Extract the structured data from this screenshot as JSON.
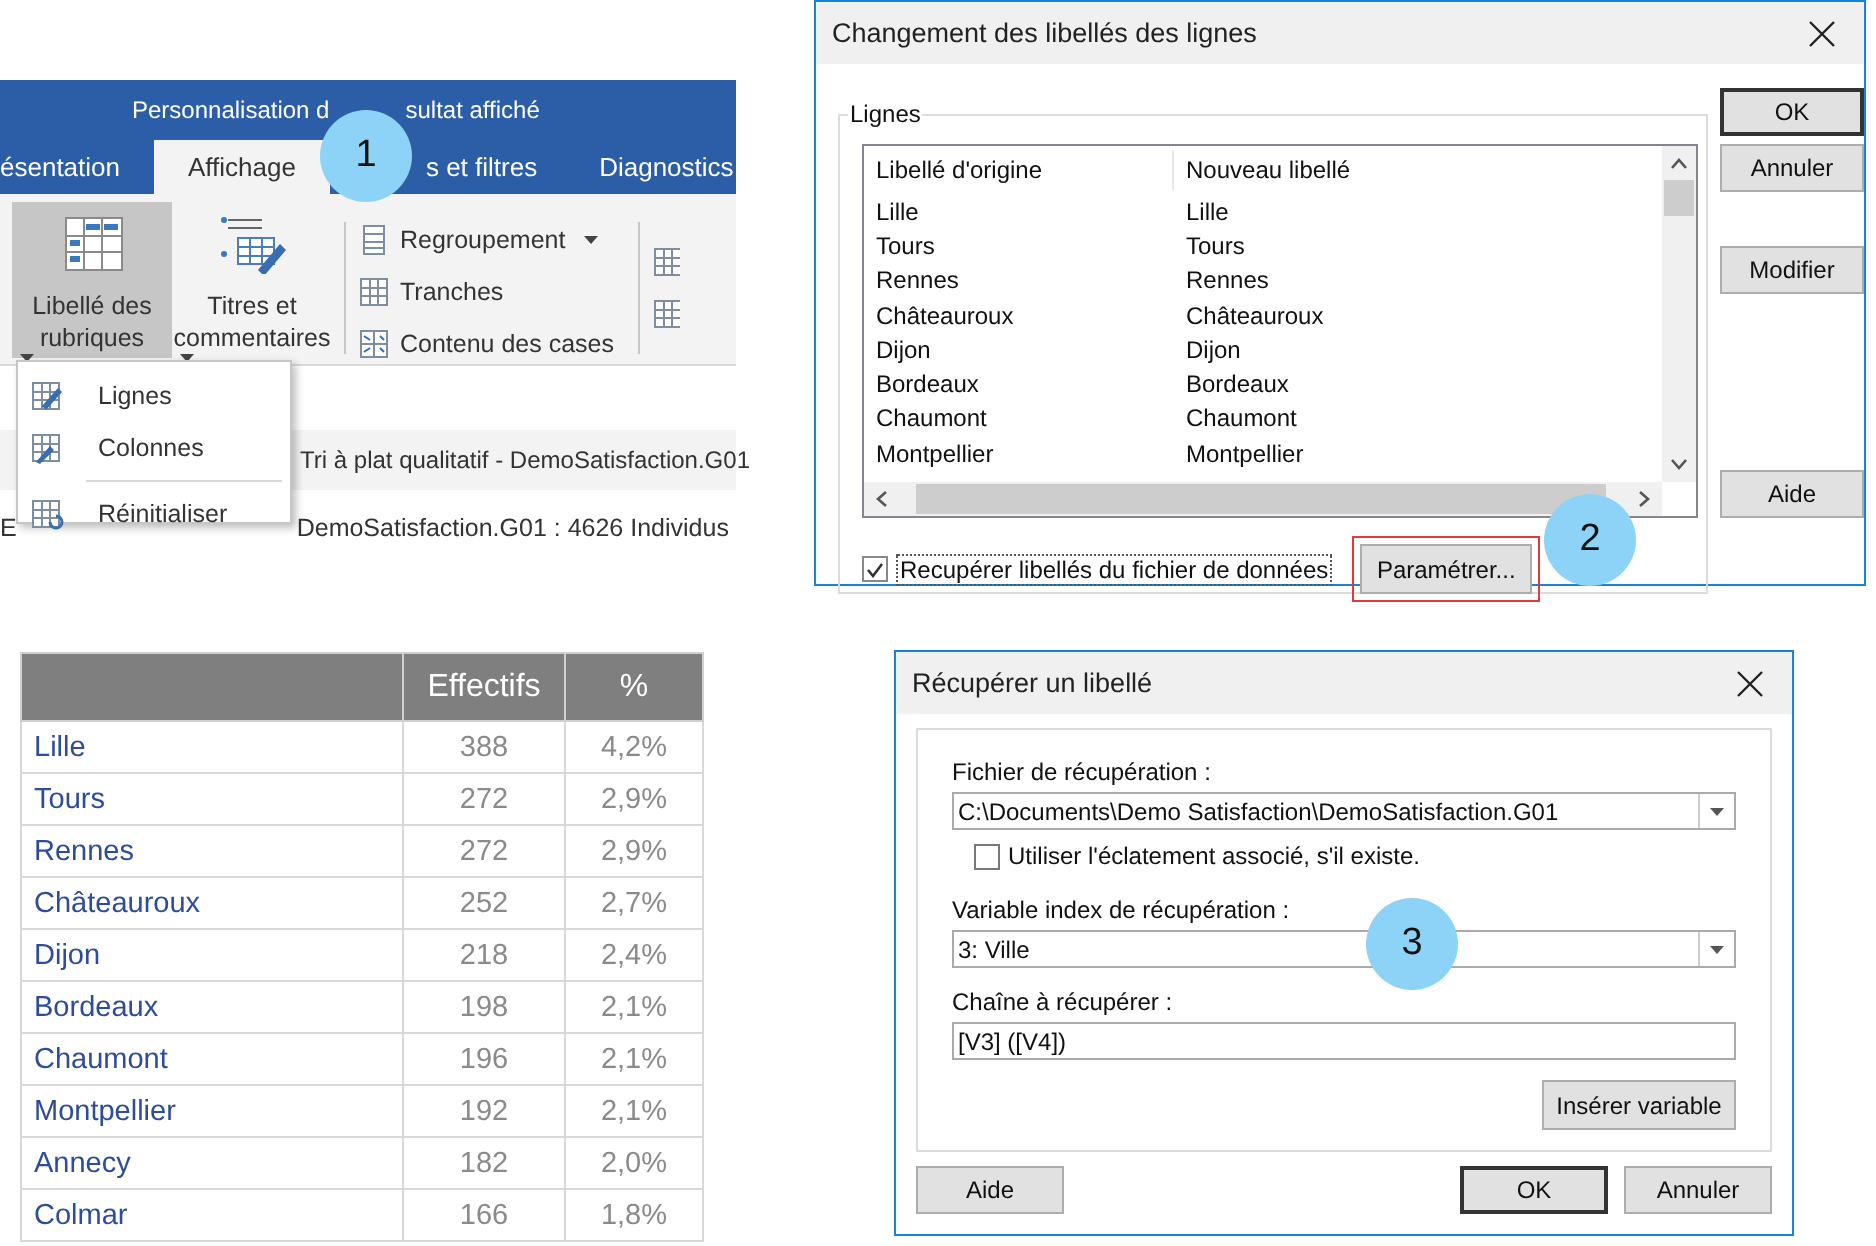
{
  "ribbon": {
    "title_parts": [
      "Personnalisation d",
      "sultat affiché"
    ],
    "tabs": [
      {
        "label": "ésentation",
        "selected": false
      },
      {
        "label": "Affichage",
        "selected": true
      },
      {
        "label": "s et filtres",
        "selected": false
      },
      {
        "label": "Diagnostics",
        "selected": false
      }
    ],
    "tools": [
      {
        "kind": "large",
        "label": "Libellé des rubriques",
        "selected": true,
        "dropdown": true
      },
      {
        "kind": "large",
        "label": "Titres et commentaires",
        "selected": false,
        "dropdown": true
      },
      {
        "kind": "small",
        "label": "Regroupement",
        "dropdown": true
      },
      {
        "kind": "small",
        "label": "Tranches",
        "dropdown": false
      },
      {
        "kind": "small",
        "label": "Contenu des cases",
        "dropdown": false
      }
    ],
    "menu": [
      {
        "kind": "item",
        "label": "Lignes"
      },
      {
        "kind": "item",
        "label": "Colonnes"
      },
      {
        "kind": "separator"
      },
      {
        "kind": "item",
        "label": "Réinitialiser"
      }
    ],
    "document_title": "Tri à plat qualitatif - DemoSatisfaction.G01",
    "status_parts": [
      "E",
      "DemoSatisfaction.G01 : 4626 Individus"
    ]
  },
  "lines_dialog": {
    "title": "Changement des libellés des lignes",
    "group_label": "Lignes",
    "columns": [
      "Libellé d'origine",
      "Nouveau libellé"
    ],
    "rows": [
      [
        "Lille",
        "Lille"
      ],
      [
        "Tours",
        "Tours"
      ],
      [
        "Rennes",
        "Rennes"
      ],
      [
        "Châteauroux",
        "Châteauroux"
      ],
      [
        "Dijon",
        "Dijon"
      ],
      [
        "Bordeaux",
        "Bordeaux"
      ],
      [
        "Chaumont",
        "Chaumont"
      ],
      [
        "Montpellier",
        "Montpellier"
      ]
    ],
    "checkbox": {
      "label": "Recupérer libellés du fichier de données",
      "checked": true
    },
    "settings_button": {
      "label": "Paramétrer...",
      "highlighted": true
    },
    "buttons": [
      {
        "label": "OK",
        "default": true
      },
      {
        "label": "Annuler",
        "default": false
      },
      {
        "label": "Modifier",
        "default": false
      },
      {
        "label": "Aide",
        "default": false
      }
    ]
  },
  "results_table": {
    "columns": [
      "Effectifs",
      "%"
    ],
    "rows": [
      {
        "label": "Lille",
        "count": "388",
        "percent": "4,2%"
      },
      {
        "label": "Tours",
        "count": "272",
        "percent": "2,9%"
      },
      {
        "label": "Rennes",
        "count": "272",
        "percent": "2,9%"
      },
      {
        "label": "Châteauroux",
        "count": "252",
        "percent": "2,7%"
      },
      {
        "label": "Dijon",
        "count": "218",
        "percent": "2,4%"
      },
      {
        "label": "Bordeaux",
        "count": "198",
        "percent": "2,1%"
      },
      {
        "label": "Chaumont",
        "count": "196",
        "percent": "2,1%"
      },
      {
        "label": "Montpellier",
        "count": "192",
        "percent": "2,1%"
      },
      {
        "label": "Annecy",
        "count": "182",
        "percent": "2,0%"
      },
      {
        "label": "Colmar",
        "count": "166",
        "percent": "1,8%"
      }
    ]
  },
  "retrieve_dialog": {
    "title": "Récupérer un libellé",
    "file_label": "Fichier de récupération :",
    "file_value": "C:\\Documents\\Demo Satisfaction\\DemoSatisfaction.G01",
    "split_checkbox": {
      "label": "Utiliser l'éclatement associé, s'il existe.",
      "checked": false
    },
    "variable_label": "Variable index de récupération :",
    "variable_value": "3: Ville",
    "string_label": "Chaîne à récupérer :",
    "string_value": "[V3] ([V4])",
    "insert_button": "Insérer variable",
    "buttons": [
      {
        "label": "Aide",
        "default": false
      },
      {
        "label": "OK",
        "default": true
      },
      {
        "label": "Annuler",
        "default": false
      }
    ]
  },
  "callouts": [
    "1",
    "2",
    "3"
  ]
}
